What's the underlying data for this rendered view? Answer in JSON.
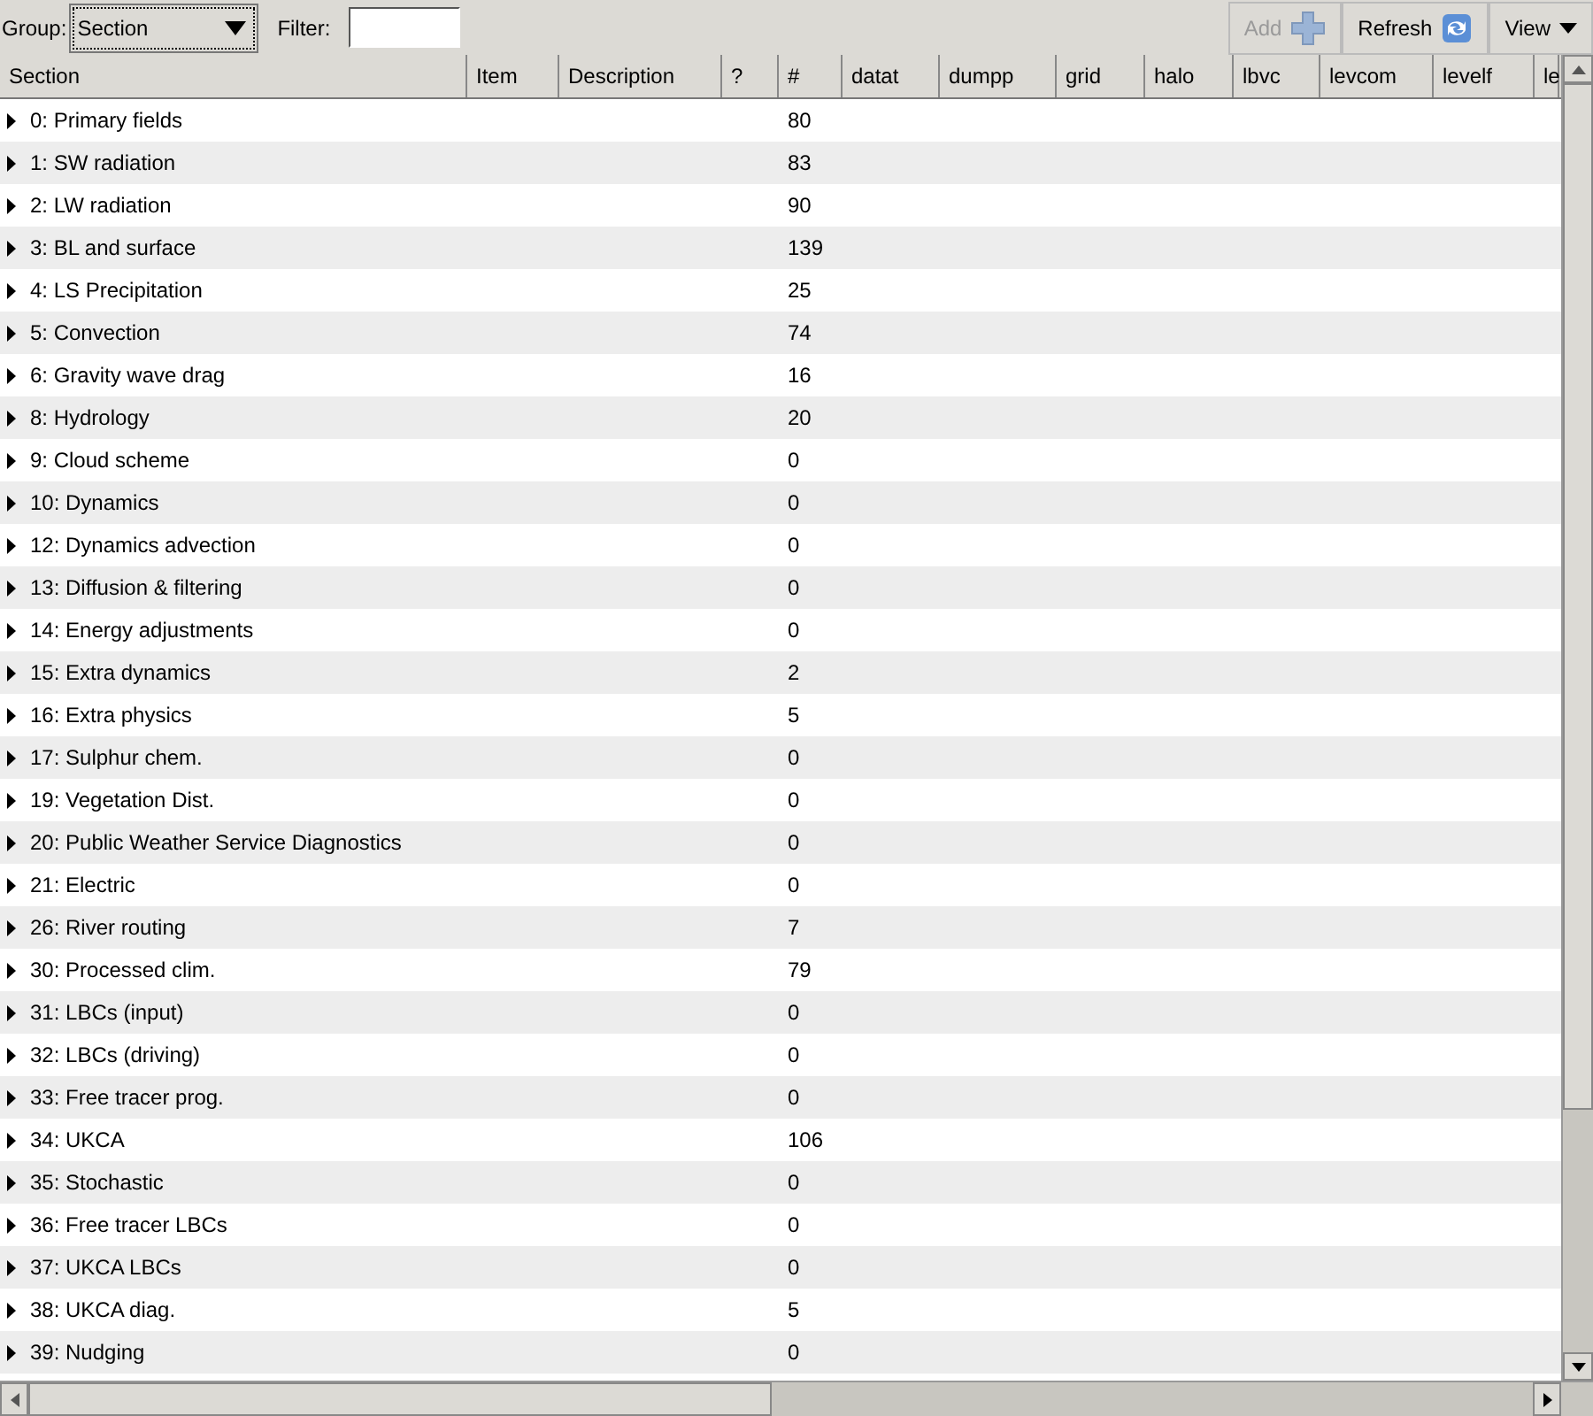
{
  "toolbar": {
    "group_label": "Group:",
    "group_value": "Section",
    "filter_label": "Filter:",
    "buttons": [
      {
        "label": "Add",
        "kind": "add",
        "disabled": true
      },
      {
        "label": "Refresh",
        "kind": "refresh",
        "disabled": false
      },
      {
        "label": "View",
        "kind": "menu",
        "disabled": false
      }
    ]
  },
  "table": {
    "columns": [
      "Section",
      "Item",
      "Description",
      "?",
      "#",
      "datat",
      "dumpp",
      "grid",
      "halo",
      "lbvc",
      "levcom",
      "levelf",
      "le"
    ],
    "rows": [
      {
        "section": "0: Primary fields",
        "count": "80"
      },
      {
        "section": "1: SW radiation",
        "count": "83"
      },
      {
        "section": "2: LW radiation",
        "count": "90"
      },
      {
        "section": "3: BL and surface",
        "count": "139"
      },
      {
        "section": "4: LS Precipitation",
        "count": "25"
      },
      {
        "section": "5: Convection",
        "count": "74"
      },
      {
        "section": "6: Gravity wave drag",
        "count": "16"
      },
      {
        "section": "8: Hydrology",
        "count": "20"
      },
      {
        "section": "9: Cloud scheme",
        "count": "0"
      },
      {
        "section": "10: Dynamics",
        "count": "0"
      },
      {
        "section": "12: Dynamics advection",
        "count": "0"
      },
      {
        "section": "13: Diffusion & filtering",
        "count": "0"
      },
      {
        "section": "14: Energy adjustments",
        "count": "0"
      },
      {
        "section": "15: Extra dynamics",
        "count": "2"
      },
      {
        "section": "16: Extra physics",
        "count": "5"
      },
      {
        "section": "17: Sulphur chem.",
        "count": "0"
      },
      {
        "section": "19: Vegetation Dist.",
        "count": "0"
      },
      {
        "section": "20: Public Weather Service Diagnostics",
        "count": "0"
      },
      {
        "section": "21: Electric",
        "count": "0"
      },
      {
        "section": "26: River routing",
        "count": "7"
      },
      {
        "section": "30: Processed clim.",
        "count": "79"
      },
      {
        "section": "31: LBCs (input)",
        "count": "0"
      },
      {
        "section": "32: LBCs (driving)",
        "count": "0"
      },
      {
        "section": "33: Free tracer prog.",
        "count": "0"
      },
      {
        "section": "34: UKCA",
        "count": "106"
      },
      {
        "section": "35: Stochastic",
        "count": "0"
      },
      {
        "section": "36: Free tracer LBCs",
        "count": "0"
      },
      {
        "section": "37: UKCA LBCs",
        "count": "0"
      },
      {
        "section": "38: UKCA diag.",
        "count": "5"
      },
      {
        "section": "39: Nudging",
        "count": "0"
      }
    ]
  }
}
